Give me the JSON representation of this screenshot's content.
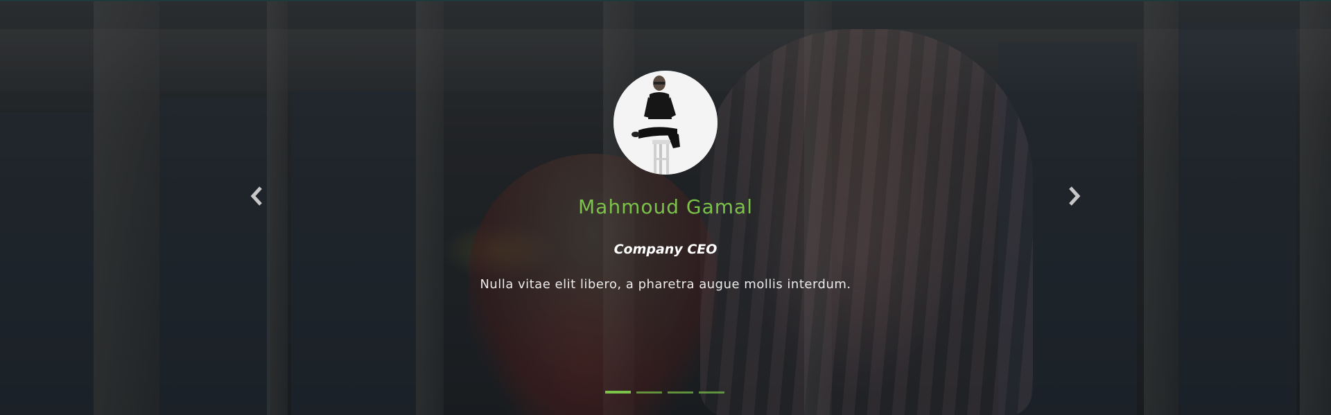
{
  "testimonial": {
    "name": "Mahmoud Gamal",
    "role": "Company CEO",
    "quote": "Nulla vitae elit libero, a pharetra augue mollis interdum."
  },
  "carousel": {
    "prev_icon": "chevron-left-icon",
    "next_icon": "chevron-right-icon",
    "slide_count": 4,
    "active_index": 0
  },
  "colors": {
    "accent": "#7cc34a",
    "text": "#ffffff"
  }
}
